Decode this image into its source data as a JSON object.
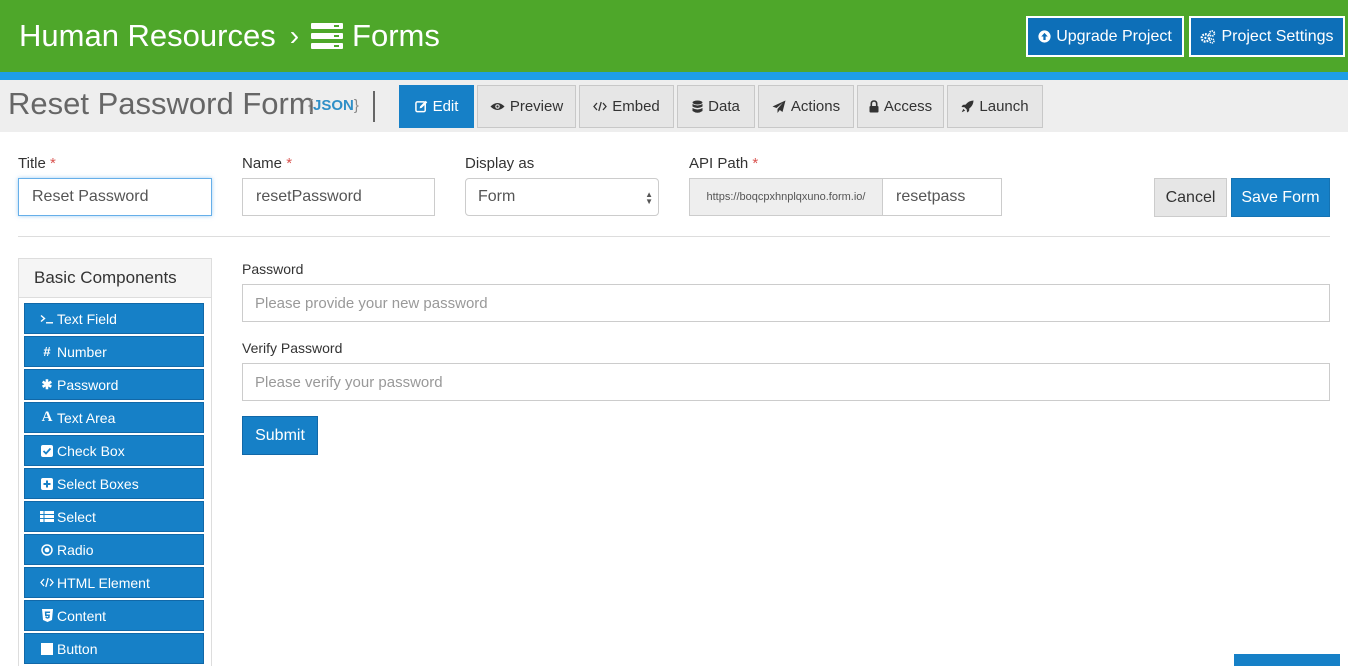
{
  "header": {
    "project": "Human Resources",
    "separator": "›",
    "section": "Forms",
    "upgrade_label": "Upgrade Project",
    "settings_label": "Project Settings"
  },
  "titlebar": {
    "form_title": "Reset Password Form",
    "json_open": "{",
    "json_label": "JSON",
    "json_close": "}"
  },
  "tabs": [
    {
      "label": "Edit",
      "icon": "edit-icon",
      "active": true
    },
    {
      "label": "Preview",
      "icon": "eye-icon"
    },
    {
      "label": "Embed",
      "icon": "code-icon"
    },
    {
      "label": "Data",
      "icon": "database-icon"
    },
    {
      "label": "Actions",
      "icon": "paper-plane-icon"
    },
    {
      "label": "Access",
      "icon": "lock-icon"
    },
    {
      "label": "Launch",
      "icon": "rocket-icon"
    }
  ],
  "settings": {
    "title_label": "Title",
    "title_value": "Reset Password",
    "name_label": "Name",
    "name_value": "resetPassword",
    "display_label": "Display as",
    "display_value": "Form",
    "api_label": "API Path",
    "api_prefix": "https://boqcpxhnplqxuno.form.io/",
    "api_value": "resetpass",
    "required_mark": "*",
    "cancel_label": "Cancel",
    "save_label": "Save Form"
  },
  "sidebar": {
    "heading": "Basic Components",
    "components": [
      {
        "label": "Text Field",
        "icon": "terminal-icon"
      },
      {
        "label": "Number",
        "icon": "hashtag-icon"
      },
      {
        "label": "Password",
        "icon": "asterisk-icon"
      },
      {
        "label": "Text Area",
        "icon": "font-icon"
      },
      {
        "label": "Check Box",
        "icon": "check-square-icon"
      },
      {
        "label": "Select Boxes",
        "icon": "plus-square-icon"
      },
      {
        "label": "Select",
        "icon": "th-list-icon"
      },
      {
        "label": "Radio",
        "icon": "dot-circle-icon"
      },
      {
        "label": "HTML Element",
        "icon": "code-icon"
      },
      {
        "label": "Content",
        "icon": "html5-icon"
      },
      {
        "label": "Button",
        "icon": "stop-icon"
      }
    ]
  },
  "preview": {
    "password_label": "Password",
    "password_placeholder": "Please provide your new password",
    "verify_label": "Verify Password",
    "verify_placeholder": "Please verify your password",
    "submit_label": "Submit"
  },
  "colors": {
    "header_green": "#4ea72a",
    "accent_blue": "#1e9ee6",
    "primary_blue": "#1680c7",
    "required_red": "#d9534f"
  }
}
